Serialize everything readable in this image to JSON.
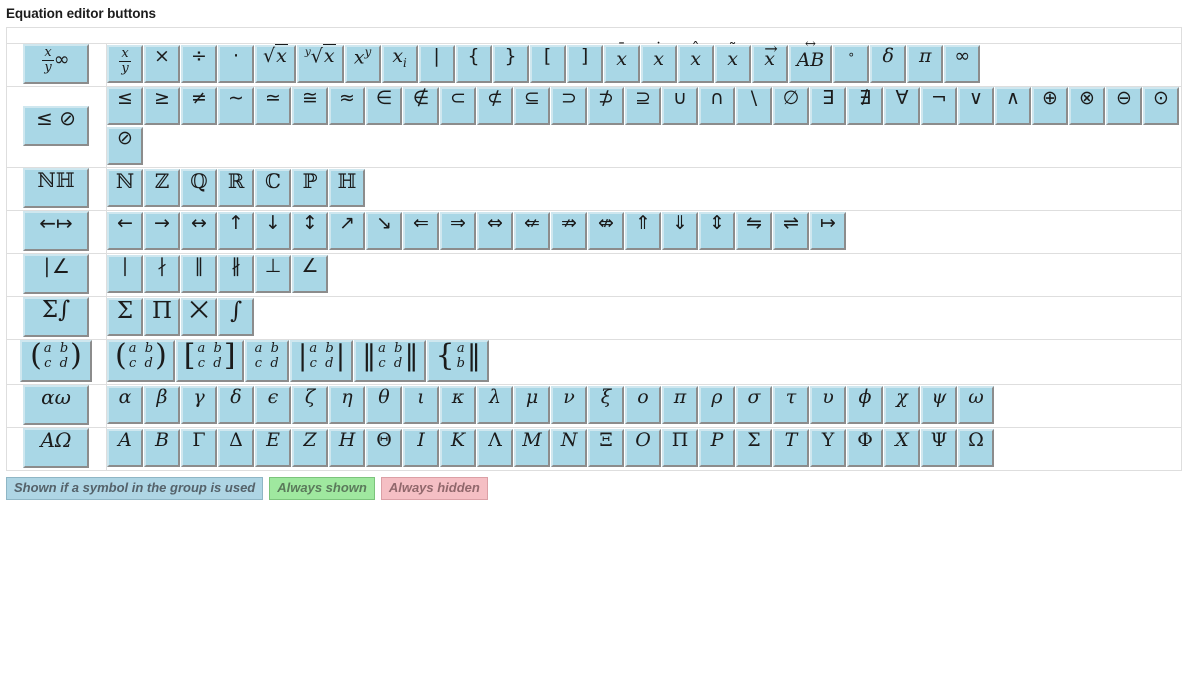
{
  "page": {
    "title": "Equation editor buttons"
  },
  "legend": {
    "items": [
      {
        "label": "Shown if a symbol in the group is used",
        "state": "used"
      },
      {
        "label": "Always shown",
        "state": "shown"
      },
      {
        "label": "Always hidden",
        "state": "hidden"
      }
    ]
  },
  "colors": {
    "button_fill": "#a9d7e6",
    "button_highlight": "#cfe7ef",
    "button_shadow": "#8c8c8c",
    "table_border": "#dedede",
    "legend_used": "#aed5e4",
    "legend_shown": "#9fe89f",
    "legend_hidden": "#f5bfc4"
  },
  "rows": [
    {
      "id": "basic",
      "group_label": "x/y ∞",
      "buttons": [
        "x/y",
        "×",
        "÷",
        "·",
        "√x",
        "ⁿ√x",
        "x^y",
        "x_i",
        "|",
        "{",
        "}",
        "[",
        "]",
        "x̄",
        "ẋ",
        "x̂",
        "x̃",
        "x⃗",
        "AB↔",
        "°",
        "δ",
        "π",
        "∞"
      ]
    },
    {
      "id": "relations",
      "group_label": "≤ ⊘",
      "buttons": [
        "≤",
        "≥",
        "≠",
        "∼",
        "≃",
        "≅",
        "≈",
        "∈",
        "∉",
        "⊂",
        "⊄",
        "⊆",
        "⊃",
        "⊅",
        "⊇",
        "∪",
        "∩",
        "\\",
        "∅",
        "∃",
        "∄",
        "∀",
        "¬",
        "∨",
        "∧",
        "⊕",
        "⊗",
        "⊖",
        "⊙",
        "⊘"
      ]
    },
    {
      "id": "numbersets",
      "group_label": "ℕℍ",
      "buttons": [
        "ℕ",
        "ℤ",
        "ℚ",
        "ℝ",
        "ℂ",
        "ℙ",
        "ℍ"
      ]
    },
    {
      "id": "arrows",
      "group_label": "←↦",
      "buttons": [
        "←",
        "→",
        "↔",
        "↑",
        "↓",
        "↕",
        "↗",
        "↘",
        "⇐",
        "⇒",
        "⇔",
        "⇍",
        "⇏",
        "⇎",
        "⇑",
        "⇓",
        "⇕",
        "⇋",
        "⇌",
        "↦"
      ]
    },
    {
      "id": "geometry",
      "group_label": "| ∠",
      "buttons": [
        "∣",
        "∤",
        "∥",
        "∦",
        "⊥",
        "∠"
      ]
    },
    {
      "id": "bigoperators",
      "group_label": "Σ∫",
      "buttons": [
        "Σ",
        "Π",
        "⨿",
        "∫"
      ]
    },
    {
      "id": "matrices",
      "group_label": "(a b / c d)",
      "buttons": [
        "(a b; c d)",
        "[a b; c d]",
        "a b; c d",
        "|a b; c d|",
        "||a b; c d||",
        "{a; b||"
      ]
    },
    {
      "id": "greek-lower",
      "group_label": "αω",
      "buttons": [
        "α",
        "β",
        "γ",
        "δ",
        "ϵ",
        "ζ",
        "η",
        "θ",
        "ι",
        "κ",
        "λ",
        "μ",
        "ν",
        "ξ",
        "o",
        "π",
        "ρ",
        "σ",
        "τ",
        "υ",
        "ϕ",
        "χ",
        "ψ",
        "ω"
      ]
    },
    {
      "id": "greek-upper",
      "group_label": "ΑΩ",
      "buttons": [
        "A",
        "B",
        "Γ",
        "Δ",
        "E",
        "Z",
        "H",
        "Θ",
        "I",
        "K",
        "Λ",
        "M",
        "N",
        "Ξ",
        "O",
        "Π",
        "P",
        "Σ",
        "T",
        "Υ",
        "Φ",
        "X",
        "Ψ",
        "Ω"
      ]
    }
  ]
}
